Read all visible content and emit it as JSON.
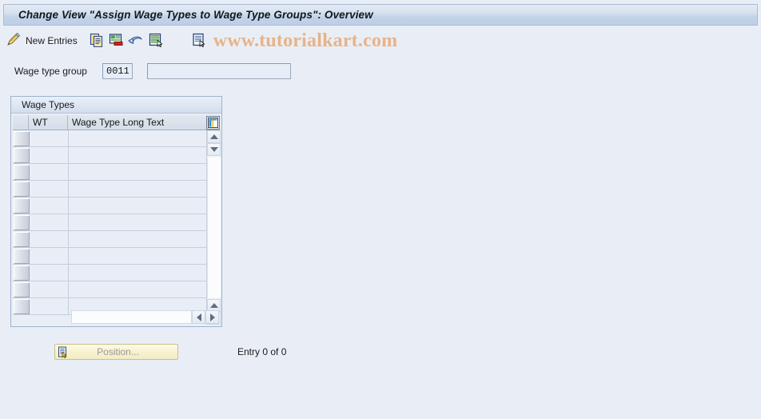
{
  "window": {
    "title": "Change View \"Assign Wage Types to Wage Type Groups\": Overview"
  },
  "toolbar": {
    "display_change_icon": "pencil-display-change-icon",
    "new_entries_label": "New Entries",
    "copy_icon": "copy-as-icon",
    "delete_icon": "delete-icon",
    "undo_icon": "undo-icon",
    "select_all_icon": "select-details-icon",
    "details_icon": "details-document-icon",
    "watermark": "www.tutorialkart.com"
  },
  "form": {
    "wage_type_group_label": "Wage type group",
    "wage_type_group_key": "0011",
    "wage_type_group_desc": "",
    "wage_type_group_desc_placeholder": ""
  },
  "table": {
    "group_title": "Wage Types",
    "columns": [
      {
        "key": "sel",
        "label": ""
      },
      {
        "key": "wt",
        "label": "WT"
      },
      {
        "key": "longtext",
        "label": "Wage Type Long Text"
      }
    ],
    "column_config_icon": "column-configuration-icon",
    "rows": [
      {
        "wt": "",
        "longtext": ""
      },
      {
        "wt": "",
        "longtext": ""
      },
      {
        "wt": "",
        "longtext": ""
      },
      {
        "wt": "",
        "longtext": ""
      },
      {
        "wt": "",
        "longtext": ""
      },
      {
        "wt": "",
        "longtext": ""
      },
      {
        "wt": "",
        "longtext": ""
      },
      {
        "wt": "",
        "longtext": ""
      },
      {
        "wt": "",
        "longtext": ""
      },
      {
        "wt": "",
        "longtext": ""
      },
      {
        "wt": "",
        "longtext": ""
      }
    ],
    "scroll": {
      "up_icon": "scroll-up-icon",
      "down_icon": "scroll-down-icon",
      "left_icon": "scroll-left-icon",
      "right_icon": "scroll-right-icon"
    }
  },
  "footer": {
    "position_label": "Position...",
    "position_icon": "position-icon",
    "entry_count": "Entry 0 of 0"
  },
  "colors": {
    "background": "#e9eef6",
    "title_bar": "#c3d3e8",
    "watermark": "#e8b387",
    "field_bg": "#e6edf6",
    "button_yellow": "#f7f1cf"
  }
}
